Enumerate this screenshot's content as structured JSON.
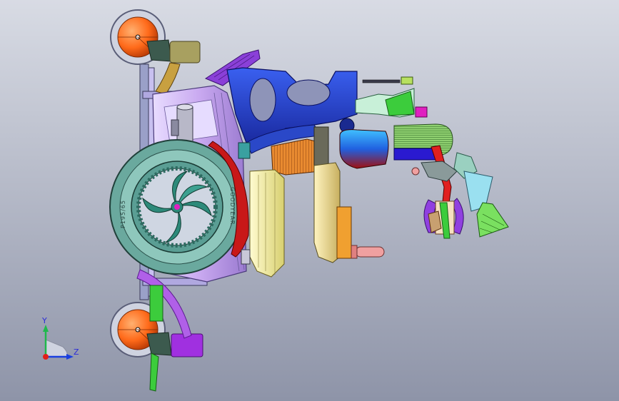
{
  "viewport": {
    "background_top": "#d8dbe4",
    "background_bottom": "#8e94a8"
  },
  "triad": {
    "y_label": "Y",
    "z_label": "Z",
    "y_color": "#1fb84c",
    "z_color": "#1a3fe0",
    "x_color": "#e0201a"
  },
  "tire": {
    "brand_text": "GOODYEAR",
    "side_text": "P195/65"
  },
  "colors": {
    "frame_blue": "#2040d0",
    "tire_teal": "#5a9e94",
    "caster_orange": "#ff6a1a",
    "seat_purple": "#c9a9f0",
    "arm_yellow": "#f5f0a8",
    "handle_orange": "#f0a030",
    "green": "#3ccc3c",
    "magenta": "#e020c0",
    "violet": "#9040e0"
  }
}
